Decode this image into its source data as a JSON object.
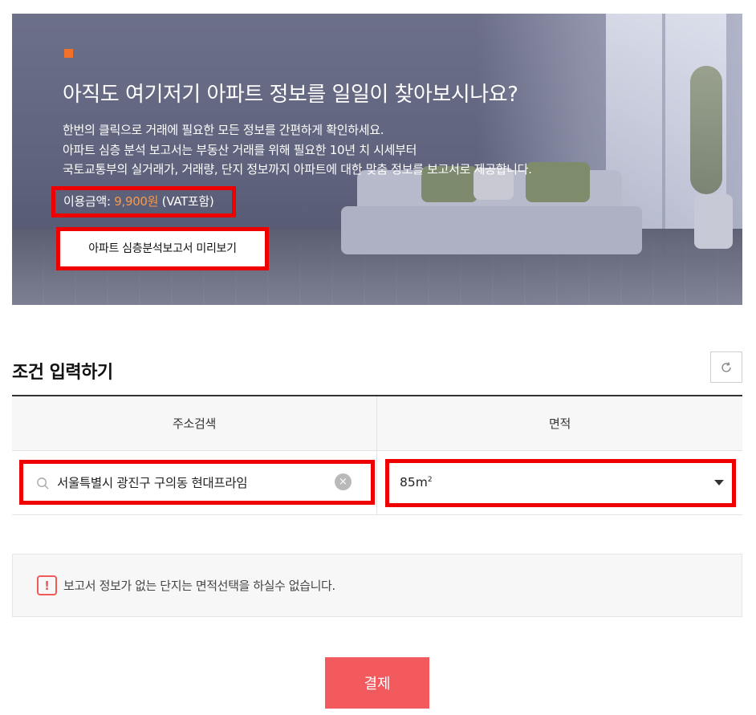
{
  "hero": {
    "title": "아직도 여기저기 아파트 정보를 일일이 찾아보시나요?",
    "desc_line1": "한번의 클릭으로 거래에 필요한 모든 정보를 간편하게 확인하세요.",
    "desc_line2": "아파트 심층 분석 보고서는 부동산 거래를 위해 필요한 10년 치 시세부터",
    "desc_line3": "국토교통부의 실거래가, 거래량, 단지 정보까지 아파트에 대한 맞춤 정보를 보고서로 제공합니다.",
    "price_label": "이용금액: ",
    "price_amount": "9,900원",
    "price_vat": " (VAT포함)",
    "preview_button": "아파트 심층분석보고서 미리보기",
    "accent_color": "#f2702a"
  },
  "section": {
    "title": "조건 입력하기",
    "refresh_icon": "refresh-icon"
  },
  "form": {
    "headers": {
      "address": "주소검색",
      "area": "면적"
    },
    "address_value": "서울특별시 광진구 구의동 현대프라임",
    "area_value": "85",
    "area_unit": "m",
    "area_unit_sup": "2",
    "clear_symbol": "×"
  },
  "notice": {
    "icon_symbol": "!",
    "text": "보고서 정보가 없는 단지는 면적선택을 하실수 없습니다."
  },
  "pay": {
    "label": "결제",
    "color": "#f25a5e"
  }
}
